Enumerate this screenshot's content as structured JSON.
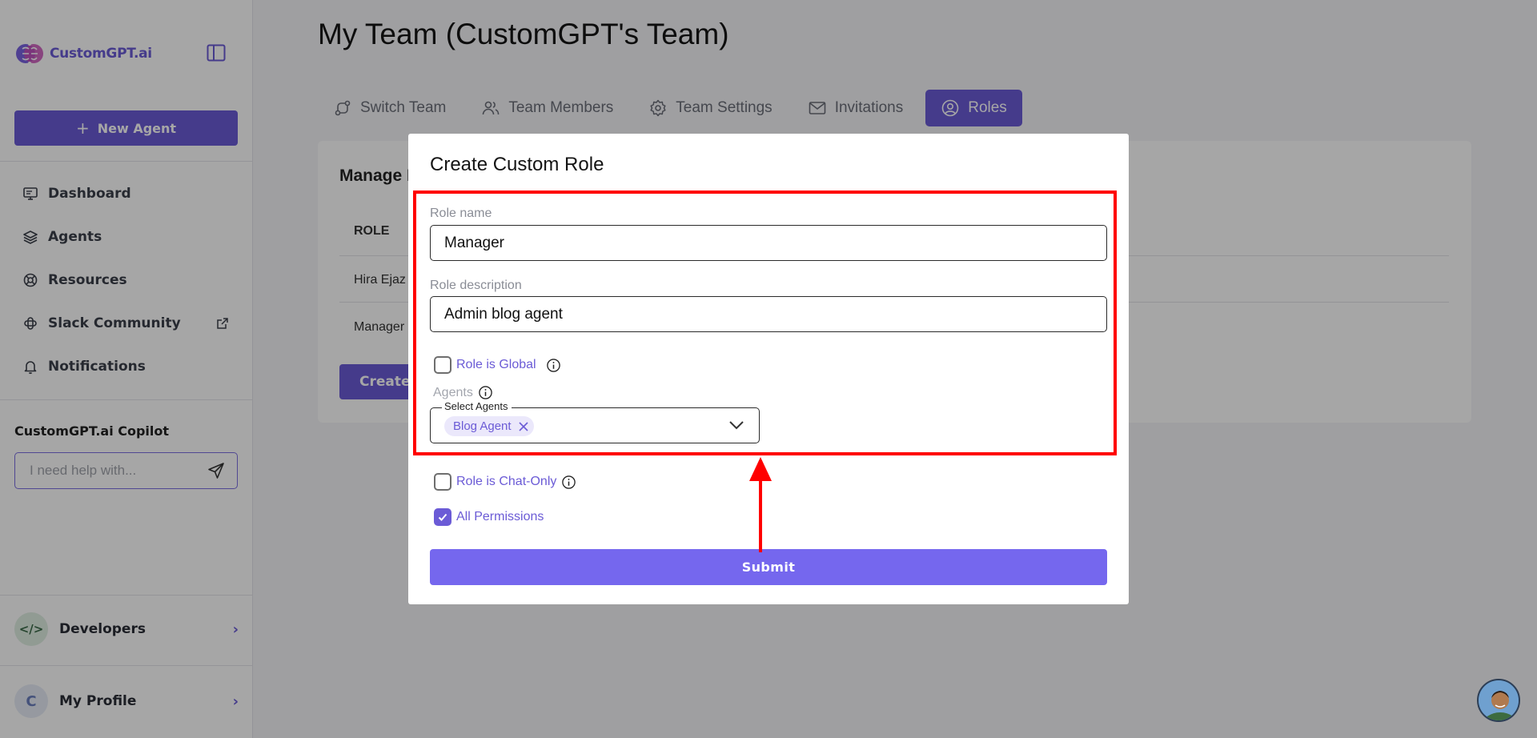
{
  "sidebar": {
    "logo_text": "CustomGPT.ai",
    "new_agent_label": "New Agent",
    "nav": [
      {
        "label": "Dashboard",
        "icon": "monitor-icon"
      },
      {
        "label": "Agents",
        "icon": "layers-icon"
      },
      {
        "label": "Resources",
        "icon": "lifebuoy-icon"
      },
      {
        "label": "Slack Community",
        "icon": "slack-icon"
      },
      {
        "label": "Notifications",
        "icon": "bell-icon"
      }
    ],
    "copilot": {
      "title": "CustomGPT.ai Copilot",
      "placeholder": "I need help with..."
    },
    "developers_label": "Developers",
    "profile_label": "My Profile",
    "profile_initial": "C"
  },
  "main": {
    "title": "My Team (CustomGPT's Team)",
    "tabs": [
      {
        "label": "Switch Team",
        "icon": "switch-icon"
      },
      {
        "label": "Team Members",
        "icon": "users-icon"
      },
      {
        "label": "Team Settings",
        "icon": "gear-icon"
      },
      {
        "label": "Invitations",
        "icon": "mail-icon"
      },
      {
        "label": "Roles",
        "icon": "user-circle-icon"
      }
    ],
    "card_title": "Manage I",
    "column_role": "ROLE",
    "rows": [
      "Hira Ejaz",
      "Manager"
    ],
    "create_label": "Create"
  },
  "modal": {
    "title": "Create Custom Role",
    "role_name_label": "Role name",
    "role_name_value": "Manager",
    "role_desc_label": "Role description",
    "role_desc_value": "Admin blog agent",
    "global_label": "Role is Global",
    "agents_label": "Agents",
    "select_legend": "Select Agents",
    "selected_agent": "Blog Agent",
    "chat_only_label": "Role is Chat-Only",
    "all_permissions_label": "All Permissions",
    "submit_label": "Submit"
  },
  "colors": {
    "accent": "#6b5bd6",
    "submit": "#7567ee",
    "annotation": "#ff0000"
  }
}
